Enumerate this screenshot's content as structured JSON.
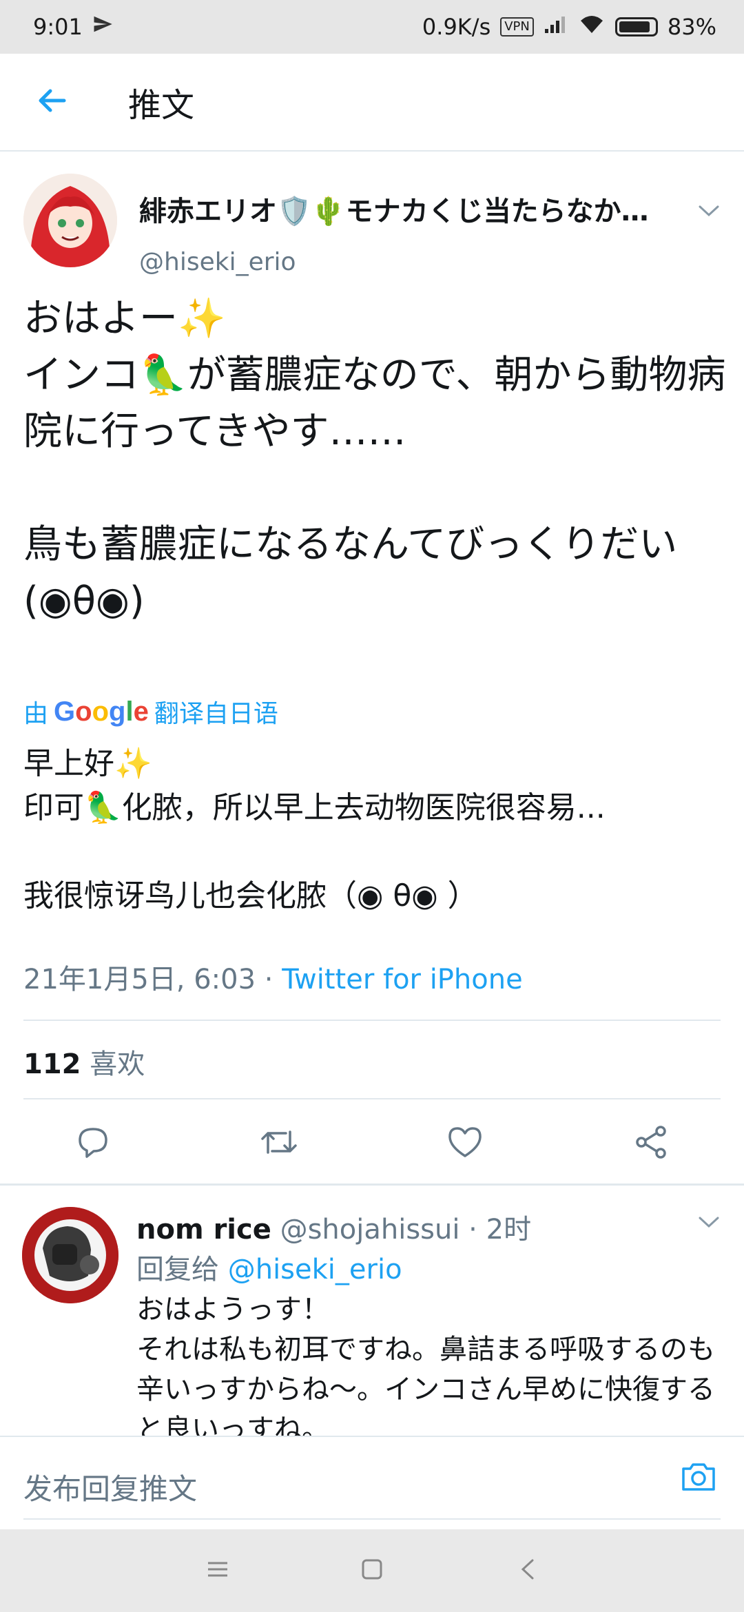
{
  "status_bar": {
    "time": "9:01",
    "net_speed": "0.9K/s",
    "vpn": "VPN",
    "battery": "83%"
  },
  "header": {
    "title": "推文"
  },
  "tweet": {
    "author_name": "緋赤エリオ🛡️🌵モナカくじ当たらなか…",
    "handle": "@hiseki_erio",
    "text_paragraphs": [
      "おはよー✨\nインコ🦜が蓄膿症なので、朝から動物病院に行ってきやす……",
      "鳥も蓄膿症になるなんてびっくりだい(◉θ◉)"
    ],
    "translate_prefix": "由",
    "translate_brand": "Google",
    "translate_suffix": "翻译自日语",
    "translation_paragraphs": [
      "早上好✨\n印可🦜化脓，所以早上去动物医院很容易...",
      "我很惊讶鸟儿也会化脓（◉ θ◉ ）"
    ],
    "timestamp": "21年1月5日, 6:03 · ",
    "source": "Twitter for iPhone",
    "likes_count": "112",
    "likes_label": " 喜欢"
  },
  "reply": {
    "name": "nom rice",
    "handle": "@shojahissui",
    "time": " · 2时",
    "reply_to_label": "回复给 ",
    "reply_to_handle": "@hiseki_erio",
    "text": "おはようっす！\nそれは私も初耳ですね。鼻詰まる呼吸するのも辛いっすからね〜。インコさん早めに快復すると良いっすね。"
  },
  "composer": {
    "placeholder": "发布回复推文"
  },
  "colors": {
    "accent": "#1da1f2",
    "secondary_text": "#657786"
  }
}
